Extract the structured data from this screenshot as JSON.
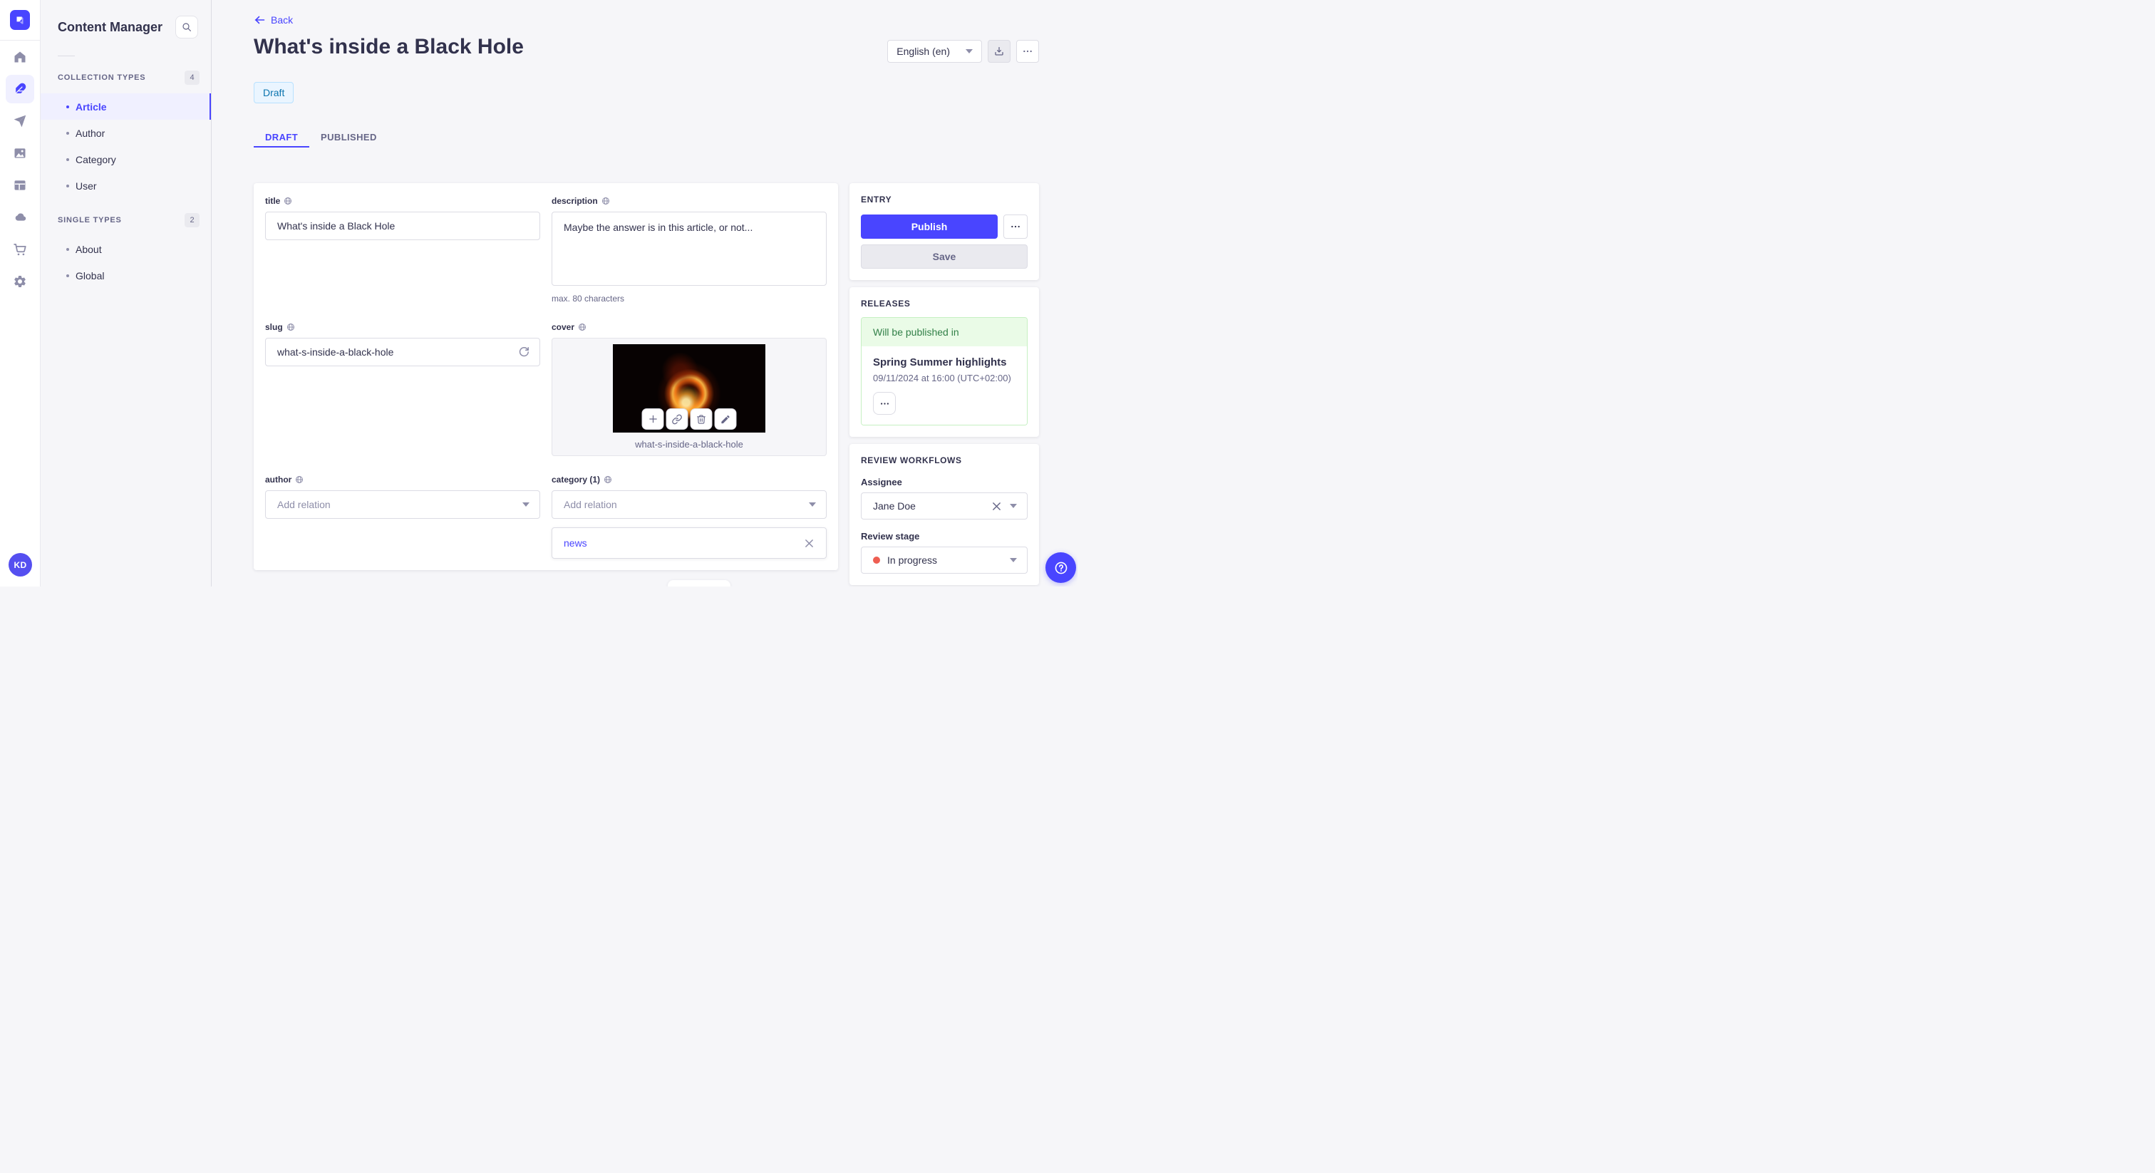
{
  "colors": {
    "primary": "#4945ff",
    "primary_light_bg": "#f0f0ff",
    "page_bg": "#f6f6f9",
    "draft_badge_bg": "#eaf5ff",
    "draft_badge_text": "#0c75af",
    "success_bg": "#eafbe7",
    "success_text": "#328048",
    "danger_dot": "#ee5e52"
  },
  "nav": {
    "logo": "strapi-logo",
    "avatar_initials": "KD",
    "items": [
      {
        "icon": "home-icon",
        "active": false
      },
      {
        "icon": "feather-icon",
        "active": true
      },
      {
        "icon": "paper-plane-icon",
        "active": false
      },
      {
        "icon": "images-icon",
        "active": false
      },
      {
        "icon": "layout-icon",
        "active": false
      },
      {
        "icon": "cloud-icon",
        "active": false
      },
      {
        "icon": "cart-icon",
        "active": false
      },
      {
        "icon": "gear-icon",
        "active": false
      }
    ]
  },
  "subnav": {
    "title": "Content Manager",
    "search_icon": "search-icon",
    "sections": [
      {
        "label": "COLLECTION TYPES",
        "count": "4",
        "items": [
          {
            "label": "Article",
            "active": true
          },
          {
            "label": "Author",
            "active": false
          },
          {
            "label": "Category",
            "active": false
          },
          {
            "label": "User",
            "active": false
          }
        ]
      },
      {
        "label": "SINGLE TYPES",
        "count": "2",
        "items": [
          {
            "label": "About",
            "active": false
          },
          {
            "label": "Global",
            "active": false
          }
        ]
      }
    ]
  },
  "header": {
    "back_label": "Back",
    "page_title": "What's inside a Black Hole",
    "status_badge": "Draft",
    "tabs": [
      {
        "label": "DRAFT",
        "active": true
      },
      {
        "label": "PUBLISHED",
        "active": false
      }
    ],
    "locale": "English (en)"
  },
  "form": {
    "title": {
      "label": "title",
      "value": "What's inside a Black Hole"
    },
    "description": {
      "label": "description",
      "value": "Maybe the answer is in this article, or not...",
      "hint": "max. 80 characters"
    },
    "slug": {
      "label": "slug",
      "value": "what-s-inside-a-black-hole"
    },
    "cover": {
      "label": "cover",
      "caption": "what-s-inside-a-black-hole",
      "action_icons": [
        "plus-icon",
        "link-icon",
        "trash-icon",
        "pencil-icon"
      ]
    },
    "author": {
      "label": "author",
      "placeholder": "Add relation"
    },
    "category": {
      "label": "category (1)",
      "placeholder": "Add relation",
      "relation": "news"
    }
  },
  "entry": {
    "title": "ENTRY",
    "publish": "Publish",
    "save": "Save"
  },
  "releases": {
    "title": "RELEASES",
    "banner": "Will be published in",
    "name": "Spring Summer highlights",
    "date": "09/11/2024 at 16:00 (UTC+02:00)"
  },
  "review": {
    "title": "REVIEW WORKFLOWS",
    "assignee_label": "Assignee",
    "assignee": "Jane Doe",
    "stage_label": "Review stage",
    "stage": "In progress"
  }
}
